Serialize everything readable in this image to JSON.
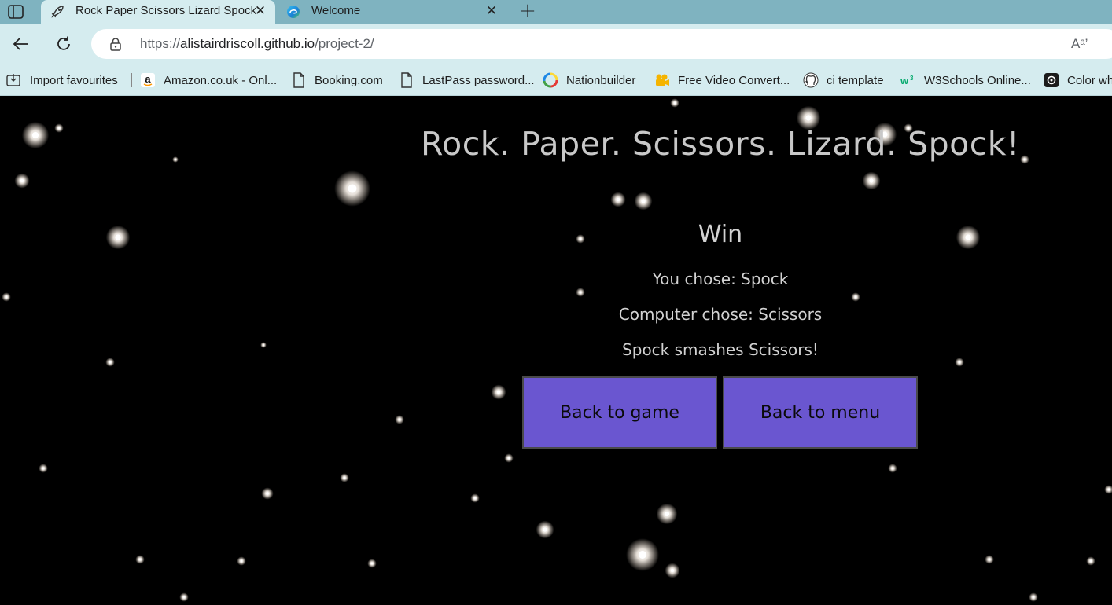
{
  "browser": {
    "tabs": [
      {
        "title": "Rock Paper Scissors Lizard Spock",
        "active": true,
        "icon": "rocket-icon"
      },
      {
        "title": "Welcome",
        "active": false,
        "icon": "edge-logo-icon"
      }
    ],
    "address": {
      "scheme": "https://",
      "host": "alistairdriscoll.github.io",
      "path": "/project-2/",
      "read_aloud_label": "Aᵃ’"
    },
    "favourites": [
      {
        "label": "Import favourites",
        "icon": "import-icon"
      },
      {
        "label": "Amazon.co.uk - Onl...",
        "icon": "amazon-icon"
      },
      {
        "label": "Booking.com",
        "icon": "page-icon"
      },
      {
        "label": "LastPass password...",
        "icon": "page-icon"
      },
      {
        "label": "Nationbuilder",
        "icon": "nationbuilder-icon"
      },
      {
        "label": "Free Video Convert...",
        "icon": "video-icon"
      },
      {
        "label": "ci template",
        "icon": "github-icon"
      },
      {
        "label": "W3Schools Online...",
        "icon": "w3schools-icon"
      },
      {
        "label": "Color wh",
        "icon": "color-icon"
      }
    ]
  },
  "game": {
    "title": "Rock. Paper. Scissors. Lizard. Spock!",
    "result_heading": "Win",
    "you_chose": "You chose: Spock",
    "computer_chose": "Computer chose: Scissors",
    "outcome_message": "Spock smashes Scissors!",
    "buttons": {
      "back_to_game": "Back to game",
      "back_to_menu": "Back to menu"
    }
  },
  "colors": {
    "tab_strip": "#7fb3c0",
    "toolbar": "#d5ecef",
    "page_background": "#000000",
    "title_text": "#c8c8c8",
    "button_fill": "#6a56d0"
  }
}
